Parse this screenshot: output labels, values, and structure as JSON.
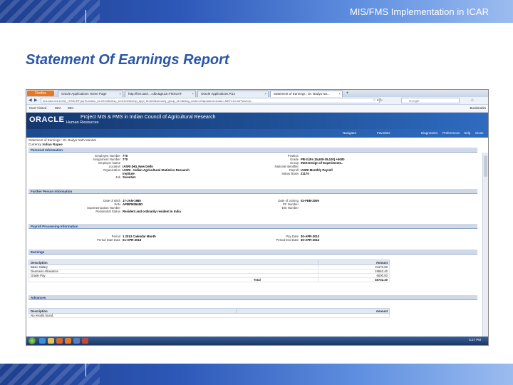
{
  "slide": {
    "header_text": "MIS/FMS Implementation in ICAR",
    "title": "Statement Of Earnings Report"
  },
  "browser": {
    "app_button": "Firefox",
    "tabs": [
      {
        "label": "Oracle Applications Home Page"
      },
      {
        "label": "http://fms.iasri...=dbc&gs13=FMSUAT"
      },
      {
        "label": "Oracle Applications R12"
      },
      {
        "label": "Statement of Earnings : Dr. Badya Na..."
      }
    ],
    "url": "fms.iasri.res.in/OA_HTML/RF.jsp?function_id=29443&resp_id=51239&resp_appl_id=800&security_group_id=0&lang_code=US&params=&oas=-MEFc1O-uIFMxZom...",
    "search_placeholder": "Google",
    "bookmarks": [
      {
        "label": "Most Visited"
      },
      {
        "label": "IBM"
      },
      {
        "label": "IBM"
      }
    ],
    "bookmarks_right": "Bookmarks"
  },
  "oracle": {
    "logo": "ORACLE",
    "sub": "Human Resources",
    "banner_title": "Project MIS & FMS in Indian Council of Agricultural Research",
    "nav": {
      "navigator": "Navigator",
      "favorites": "Favorites",
      "diagnostics": "Diagnostics",
      "preferences": "Preferences",
      "help": "Help",
      "close": "Close Window"
    }
  },
  "report": {
    "breadcrumb": "Statement of Earnings : Dr. Badya Nath Mandal",
    "currency_label": "Currency",
    "currency_value": "Indian Rupee",
    "personal": {
      "heading": "Personal Information",
      "left": [
        {
          "k": "Employee Number",
          "v": "770"
        },
        {
          "k": "Assignment Number",
          "v": "770"
        },
        {
          "k": "Employer Name",
          "v": ""
        },
        {
          "k": "Location",
          "v": "IASRI (HI), New Delhi"
        },
        {
          "k": "Organization",
          "v": "IASRI - Indian Agricultural Statistics Research"
        },
        {
          "k": "",
          "v": "Institute"
        },
        {
          "k": "Job",
          "v": "Scientist."
        }
      ],
      "right": [
        {
          "k": "Position",
          "v": ""
        },
        {
          "k": "Grade",
          "v": "PB-3 (Rs 15,600-39,100) +6000"
        },
        {
          "k": "Group",
          "v": "INST.Design of Experiments.."
        },
        {
          "k": "National Identifier",
          "v": ""
        },
        {
          "k": "Payroll",
          "v": "IASRI Monthly Payroll"
        },
        {
          "k": "Salary Basis",
          "v": "21170"
        }
      ]
    },
    "further": {
      "heading": "Further Person Information",
      "left": [
        {
          "k": "Date of Birth",
          "v": "17-JAN-1980"
        },
        {
          "k": "PAN",
          "v": "APBPM3545D"
        },
        {
          "k": "Superannuation Number",
          "v": ""
        },
        {
          "k": "Residential Status",
          "v": "Resident and ordinarily resident in India"
        }
      ],
      "right": [
        {
          "k": "Date of Joining",
          "v": "02-FEB-2009"
        },
        {
          "k": "PF Number",
          "v": ""
        },
        {
          "k": "ESI Number",
          "v": ""
        }
      ]
    },
    "payroll": {
      "heading": "Payroll Processing Information",
      "left": [
        {
          "k": "Period",
          "v": "1 2013 Calendar Month"
        },
        {
          "k": "Period Start Date",
          "v": "01-APR-2013"
        }
      ],
      "right": [
        {
          "k": "Pay Date",
          "v": "30-APR-2013"
        },
        {
          "k": "Period End Date",
          "v": "30-APR-2013"
        }
      ]
    },
    "earnings": {
      "heading": "Earnings",
      "col_desc": "Description",
      "col_amt": "Amount",
      "rows": [
        {
          "d": "Basic Salary",
          "a": "21170.00"
        },
        {
          "d": "Dearness Allowance",
          "a": "19562.40"
        },
        {
          "d": "Grade Pay",
          "a": "6000.00"
        }
      ],
      "total_label": "Total",
      "total_value": "46732.40"
    },
    "advances": {
      "heading": "Advances",
      "col_desc": "Description",
      "col_amt": "Amount",
      "empty": "No results found."
    }
  },
  "taskbar": {
    "clock": "5:27 PM"
  }
}
